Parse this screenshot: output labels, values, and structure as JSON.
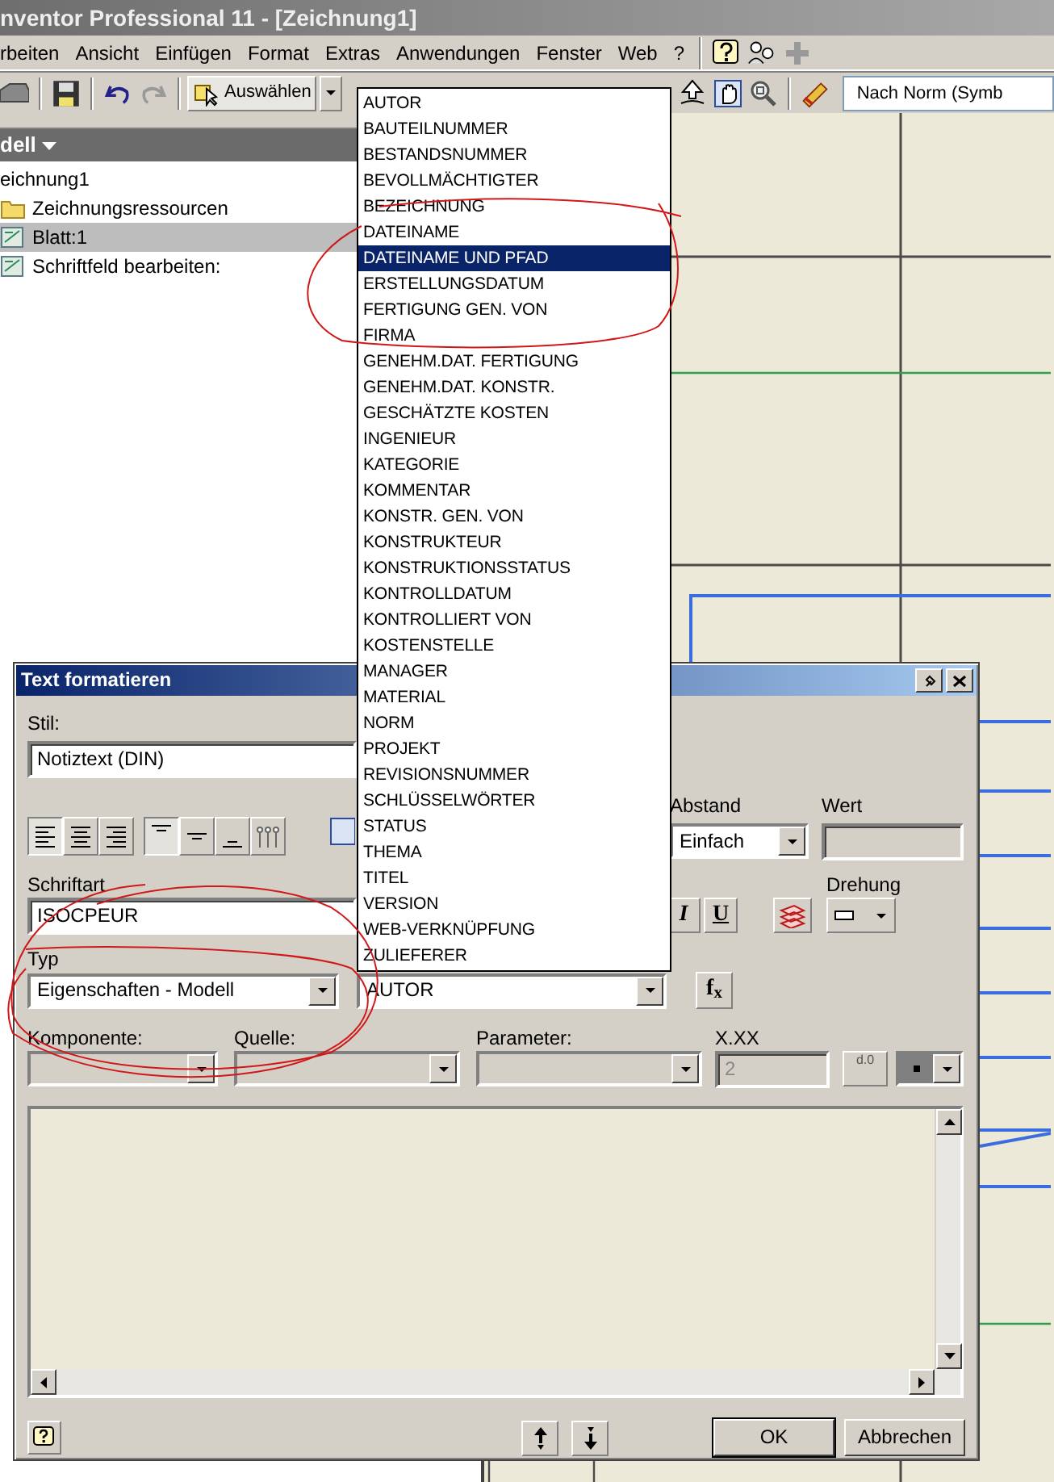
{
  "window": {
    "title": "nventor Professional 11 - [Zeichnung1]"
  },
  "menu": [
    "rbeiten",
    "Ansicht",
    "Einfügen",
    "Format",
    "Extras",
    "Anwendungen",
    "Fenster",
    "Web",
    "?"
  ],
  "toolbar": {
    "select_tool": "Auswählen",
    "style_combo": "Nach Norm (Symb"
  },
  "browser": {
    "header": "dell",
    "tree": [
      {
        "label": "eichnung1",
        "selected": false,
        "children": [
          {
            "label": "Zeichnungsressourcen",
            "kind": "folder",
            "selected": false
          },
          {
            "label": "Blatt:1",
            "kind": "sheet",
            "selected": true
          },
          {
            "label": "Schriftfeld bearbeiten:",
            "kind": "sheet",
            "selected": false
          }
        ]
      }
    ]
  },
  "dialog": {
    "title": "Text formatieren",
    "style_label": "Stil:",
    "style_value": "Notiztext (DIN)",
    "align_buttons": [
      {
        "kind": "h-left",
        "pressed": true
      },
      {
        "kind": "h-center",
        "pressed": false
      },
      {
        "kind": "h-right",
        "pressed": false
      },
      {
        "kind": "v-top",
        "pressed": true
      },
      {
        "kind": "v-middle",
        "pressed": false
      },
      {
        "kind": "v-bottom",
        "pressed": false
      },
      {
        "kind": "stack",
        "pressed": false
      }
    ],
    "spacing_label": "Abstand",
    "spacing_value": "Einfach",
    "value_label": "Wert",
    "font_label": "Schriftart",
    "font_value": "ISOCPEUR",
    "format_buttons": [
      {
        "kind": "italic",
        "text": "I"
      },
      {
        "kind": "underline",
        "text": "U"
      }
    ],
    "rotation_label": "Drehung",
    "type_label": "Typ",
    "type_value": "Eigenschaften - Modell",
    "property_value": "AUTOR",
    "function_button": "f$_{x}$",
    "component_label": "Komponente:",
    "source_label": "Quelle:",
    "parameter_label": "Parameter:",
    "precision_label": "X.XX",
    "precision_value": "2",
    "precision_button": "d.0",
    "ok": "OK",
    "cancel": "Abbrechen"
  },
  "property_list": [
    {
      "label": "AUTOR",
      "selected": false
    },
    {
      "label": "BAUTEILNUMMER",
      "selected": false
    },
    {
      "label": "BESTANDSNUMMER",
      "selected": false
    },
    {
      "label": "BEVOLLMÄCHTIGTER",
      "selected": false
    },
    {
      "label": "BEZEICHNUNG",
      "selected": false
    },
    {
      "label": "DATEINAME",
      "selected": false
    },
    {
      "label": "DATEINAME UND PFAD",
      "selected": true
    },
    {
      "label": "ERSTELLUNGSDATUM",
      "selected": false
    },
    {
      "label": "FERTIGUNG GEN. VON",
      "selected": false
    },
    {
      "label": "FIRMA",
      "selected": false
    },
    {
      "label": "GENEHM.DAT. FERTIGUNG",
      "selected": false
    },
    {
      "label": "GENEHM.DAT. KONSTR.",
      "selected": false
    },
    {
      "label": "GESCHÄTZTE KOSTEN",
      "selected": false
    },
    {
      "label": "INGENIEUR",
      "selected": false
    },
    {
      "label": "KATEGORIE",
      "selected": false
    },
    {
      "label": "KOMMENTAR",
      "selected": false
    },
    {
      "label": "KONSTR. GEN. VON",
      "selected": false
    },
    {
      "label": "KONSTRUKTEUR",
      "selected": false
    },
    {
      "label": "KONSTRUKTIONSSTATUS",
      "selected": false
    },
    {
      "label": "KONTROLLDATUM",
      "selected": false
    },
    {
      "label": "KONTROLLIERT VON",
      "selected": false
    },
    {
      "label": "KOSTENSTELLE",
      "selected": false
    },
    {
      "label": "MANAGER",
      "selected": false
    },
    {
      "label": "MATERIAL",
      "selected": false
    },
    {
      "label": "NORM",
      "selected": false
    },
    {
      "label": "PROJEKT",
      "selected": false
    },
    {
      "label": "REVISIONSNUMMER",
      "selected": false
    },
    {
      "label": "SCHLÜSSELWÖRTER",
      "selected": false
    },
    {
      "label": "STATUS",
      "selected": false
    },
    {
      "label": "THEMA",
      "selected": false
    },
    {
      "label": "TITEL",
      "selected": false
    },
    {
      "label": "VERSION",
      "selected": false
    },
    {
      "label": "WEB-VERKNÜPFUNG",
      "selected": false
    },
    {
      "label": "ZULIEFERER",
      "selected": false
    }
  ]
}
